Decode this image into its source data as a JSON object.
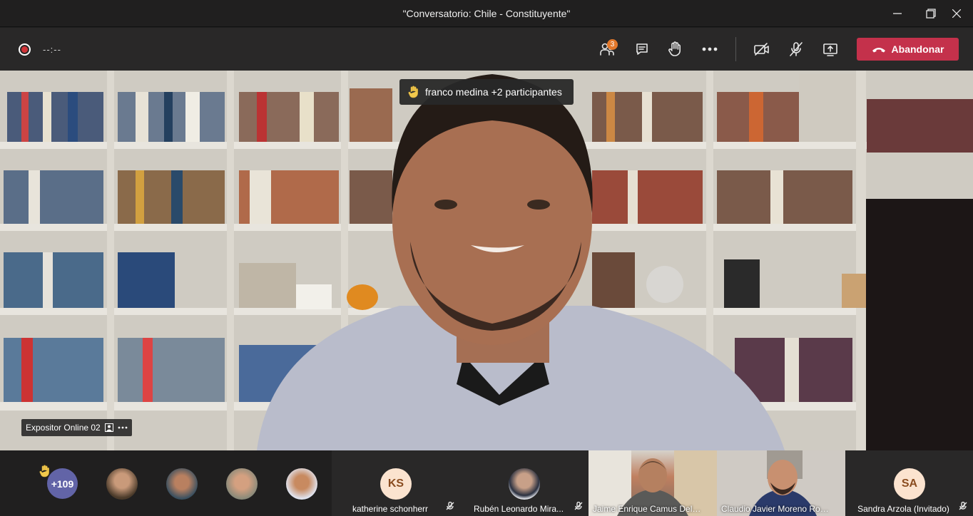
{
  "window": {
    "title": "\"Conversatorio: Chile - Constituyente\""
  },
  "toolbar": {
    "timer": "--:--",
    "participants_badge": "3",
    "leave_label": "Abandonar"
  },
  "stage": {
    "raised_hand_notice": "franco medina +2 participantes",
    "speaker_name": "Expositor Online 02"
  },
  "strip": {
    "overflow_count": "+109",
    "tiles": [
      {
        "initials": "KS",
        "name": "katherine schonherr"
      },
      {
        "name": "Rubén Leonardo Mira..."
      },
      {
        "name": "Jaime Enrique Camus Del ..."
      },
      {
        "name": "Claudio Javier Moreno Rojas"
      },
      {
        "initials": "SA",
        "name": "Sandra Arzola (Invitado)"
      }
    ]
  },
  "colors": {
    "leave_button": "#c4314b",
    "overflow_avatar": "#6264a7",
    "badge": "#e3782b"
  }
}
